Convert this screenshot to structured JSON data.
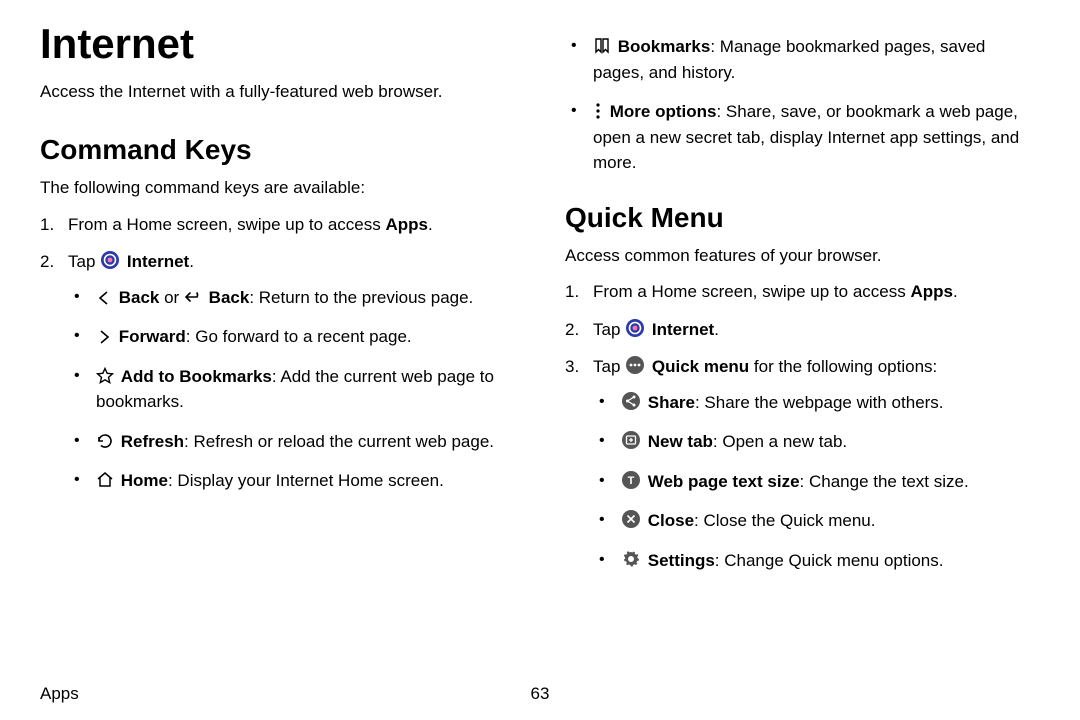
{
  "page_title": "Internet",
  "intro": "Access the Internet with a fully-featured web browser.",
  "section1": {
    "heading": "Command Keys",
    "lead": "The following command keys are available:",
    "step1_prefix": "From a Home screen, swipe up to access ",
    "step1_bold": "Apps",
    "step1_suffix": ".",
    "step2_prefix": "Tap ",
    "step2_bold": "Internet",
    "step2_suffix": ".",
    "bullets": {
      "back_bold1": "Back",
      "back_or": " or ",
      "back_bold2": "Back",
      "back_rest": ": Return to the previous page.",
      "forward_bold": "Forward",
      "forward_rest": ": Go forward to a recent page.",
      "addbm_bold": "Add to Bookmarks",
      "addbm_rest": ": Add the current web page to bookmarks.",
      "refresh_bold": "Refresh",
      "refresh_rest": ": Refresh or reload the current web page.",
      "home_bold": "Home",
      "home_rest": ": Display your Internet Home screen.",
      "bookmarks_bold": "Bookmarks",
      "bookmarks_rest": ": Manage bookmarked pages, saved pages, and history.",
      "more_bold": "More options",
      "more_rest": ": Share, save, or bookmark a web page, open a new secret tab, display Internet app settings, and more."
    }
  },
  "section2": {
    "heading": "Quick Menu",
    "lead": "Access common features of your browser.",
    "step1_prefix": "From a Home screen, swipe up to access ",
    "step1_bold": "Apps",
    "step1_suffix": ".",
    "step2_prefix": "Tap ",
    "step2_bold": "Internet",
    "step2_suffix": ".",
    "step3_prefix": "Tap ",
    "step3_bold": "Quick menu",
    "step3_suffix": " for the following options:",
    "bullets": {
      "share_bold": "Share",
      "share_rest": ": Share the webpage with others.",
      "newtab_bold": "New tab",
      "newtab_rest": ": Open a new tab.",
      "textsize_bold": "Web page text size",
      "textsize_rest": ": Change the text size.",
      "close_bold": "Close",
      "close_rest": ": Close the Quick menu.",
      "settings_bold": "Settings",
      "settings_rest": ": Change Quick menu options."
    }
  },
  "footer": {
    "section": "Apps",
    "page": "63"
  }
}
